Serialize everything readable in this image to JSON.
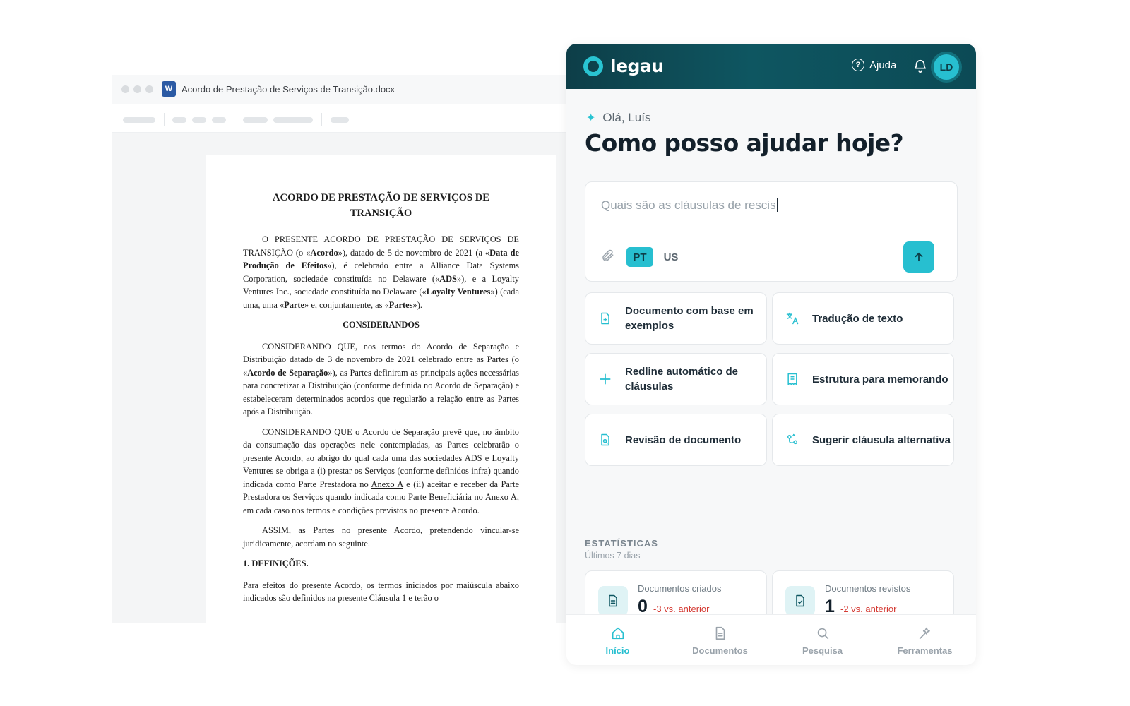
{
  "word": {
    "filename": "Acordo de Prestação de Serviços de Transição.docx",
    "app_icon": "W",
    "doc": {
      "title": "ACORDO DE PRESTAÇÃO DE SERVIÇOS DE TRANSIÇÃO",
      "intro": {
        "a": "O PRESENTE ACORDO DE PRESTAÇÃO DE SERVIÇOS DE TRANSIÇÃO (o «",
        "b": "Acordo",
        "c": "»), datado de 5 de novembro de 2021 (a «",
        "d": "Data de Produção de Efeitos",
        "e": "»), é celebrado entre a Alliance Data Systems Corporation, sociedade constituída no Delaware («",
        "f": "ADS",
        "g": "»), e a Loyalty Ventures Inc., sociedade constituída no Delaware («",
        "h": "Loyalty Ventures",
        "i": "») (cada uma, uma «",
        "j": "Parte",
        "k": "» e, conjuntamente, as «",
        "l": "Partes",
        "m": "»)."
      },
      "heading_considerandos": "CONSIDERANDOS",
      "p1": {
        "a": "CONSIDERANDO QUE, nos termos do Acordo de Separação e Distribuição datado de 3 de novembro de 2021 celebrado entre as Partes (o «",
        "b": "Acordo de Separação",
        "c": "»), as Partes definiram as principais ações necessárias para concretizar a Distribuição (conforme definida no Acordo de Separação) e estabeleceram determinados acordos que regularão a relação entre as Partes após a Distribuição."
      },
      "p2": {
        "a": "CONSIDERANDO QUE o Acordo de Separação prevê que, no âmbito da consumação das operações nele contempladas, as Partes celebrarão o presente Acordo, ao abrigo do qual cada uma das sociedades ADS e Loyalty Ventures se obriga a (i) prestar os Serviços (conforme definidos infra) quando indicada como Parte Prestadora no ",
        "b": "Anexo A",
        "c": " e (ii) aceitar e receber da Parte Prestadora os Serviços quando indicada como Parte Beneficiária no ",
        "d": "Anexo A",
        "e": ", em cada caso nos termos e condições previstos no presente Acordo."
      },
      "p3": "ASSIM, as Partes no presente Acordo, pretendendo vincular-se juridicamente, acordam no seguinte.",
      "section1": "1.   DEFINIÇÕES.",
      "p4": {
        "a": "Para efeitos do presente Acordo, os termos iniciados por maiúscula abaixo indicados são definidos na presente ",
        "b": "Cláusula 1",
        "c": " e terão o"
      }
    }
  },
  "legau": {
    "brand": "legau",
    "help_label": "Ajuda",
    "help_icon": "question-circle-icon",
    "avatar_initials": "LD",
    "greeting": "Olá, Luís",
    "headline": "Como posso ajudar hoje?",
    "input_value": "Quais são as cláusulas de rescis",
    "lang_active": "PT",
    "lang_other": "US",
    "actions": [
      {
        "label": "Documento com base em exemplos",
        "icon": "doc-plus-icon"
      },
      {
        "label": "Tradução de texto",
        "icon": "translate-icon"
      },
      {
        "label": "Redline automático de cláusulas",
        "icon": "plus-icon"
      },
      {
        "label": "Estrutura para memorando",
        "icon": "memo-icon"
      },
      {
        "label": "Revisão de documento",
        "icon": "doc-search-icon"
      },
      {
        "label": "Sugerir cláusula alternativa",
        "icon": "branch-icon"
      }
    ],
    "stats_title": "ESTATÍSTICAS",
    "stats_subtitle": "Últimos 7 dias",
    "stats": [
      {
        "label": "Documentos criados",
        "value": "0",
        "delta": "-3 vs. anterior"
      },
      {
        "label": "Documentos revistos",
        "value": "1",
        "delta": "-2 vs. anterior"
      }
    ],
    "nav": [
      {
        "label": "Início",
        "active": true
      },
      {
        "label": "Documentos",
        "active": false
      },
      {
        "label": "Pesquisa",
        "active": false
      },
      {
        "label": "Ferramentas",
        "active": false
      }
    ],
    "colors": {
      "accent": "#27bfd0",
      "header": "#0e5661",
      "negative": "#d43a33"
    }
  }
}
